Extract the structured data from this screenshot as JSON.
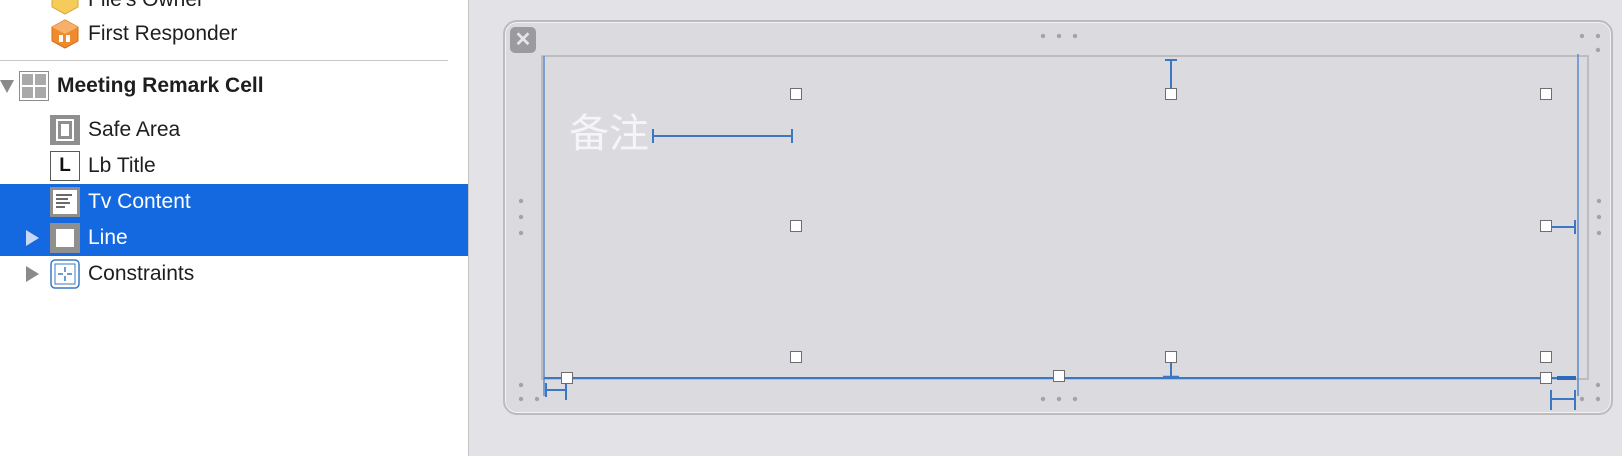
{
  "outline": {
    "items": [
      {
        "label": "File's Owner",
        "icon": "cube-yellow-icon"
      },
      {
        "label": "First Responder",
        "icon": "cube-orange-icon"
      },
      {
        "label": "Meeting Remark Cell",
        "icon": "table-cell-icon",
        "expanded": true
      },
      {
        "label": "Safe Area",
        "icon": "safe-area-icon"
      },
      {
        "label": "Lb Title",
        "icon": "label-L-icon"
      },
      {
        "label": "Tv Content",
        "icon": "text-view-icon",
        "selected": true
      },
      {
        "label": "Line",
        "icon": "view-icon",
        "selected": true,
        "expandable": true
      },
      {
        "label": "Constraints",
        "icon": "constraints-icon",
        "expandable": true
      }
    ]
  },
  "canvas": {
    "cell_label_text": "备注",
    "close_glyph": "✕"
  },
  "colors": {
    "selection": "#1468e0",
    "constraint": "#3b78c4",
    "canvas_bg": "#e3e3e7",
    "cell_bg": "#dadadf"
  }
}
